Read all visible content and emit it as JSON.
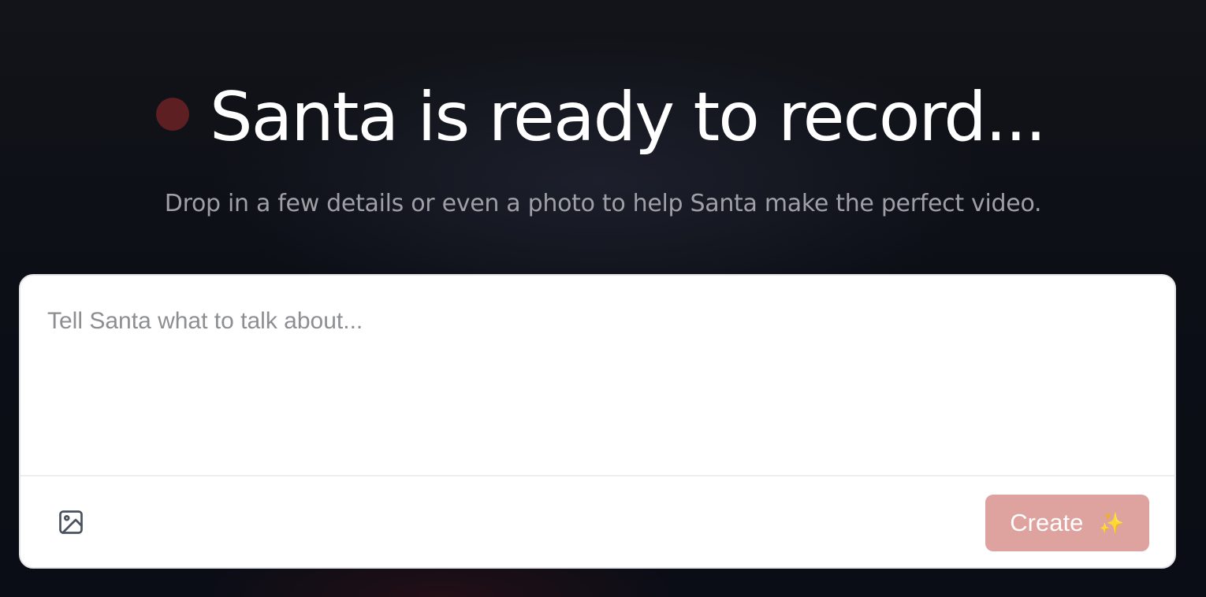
{
  "hero": {
    "title": "Santa is ready to record...",
    "subtitle": "Drop in a few details or even a photo to help Santa make the perfect video."
  },
  "composer": {
    "placeholder": "Tell Santa what to talk about...",
    "value": "",
    "upload_icon": "image-icon",
    "create_label": "Create",
    "create_icon": "sparkles-icon"
  },
  "colors": {
    "background": "#0d0f17",
    "record_dot": "#5e1f22",
    "create_button": "#dea29f",
    "subtitle_text": "#9ea0a6",
    "placeholder_text": "#8d8e92"
  }
}
